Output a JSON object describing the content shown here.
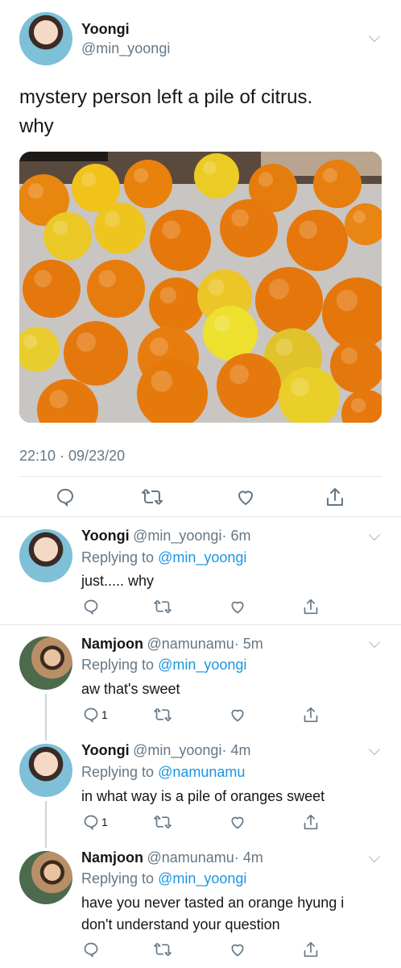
{
  "main_tweet": {
    "author_name": "Yoongi",
    "author_handle": "@min_yoongi",
    "text_line1": "mystery person left a pile of citrus.",
    "text_line2": "why",
    "timestamp": "22:10 · 09/23/20"
  },
  "replies": [
    {
      "author_name": "Yoongi",
      "author_handle": "@min_yoongi",
      "time": "· 6m",
      "replying_prefix": "Replying to ",
      "replying_to": "@min_yoongi",
      "text": "just..... why",
      "reply_count": ""
    },
    {
      "author_name": "Namjoon",
      "author_handle": "@namunamu",
      "time": "· 5m",
      "replying_prefix": "Replying to ",
      "replying_to": "@min_yoongi",
      "text": "aw that's sweet",
      "reply_count": "1"
    },
    {
      "author_name": "Yoongi",
      "author_handle": "@min_yoongi",
      "time": "· 4m",
      "replying_prefix": "Replying to ",
      "replying_to": "@namunamu",
      "text": "in what way is a pile of oranges sweet",
      "reply_count": "1"
    },
    {
      "author_name": "Namjoon",
      "author_handle": "@namunamu",
      "time": "· 4m",
      "replying_prefix": "Replying to ",
      "replying_to": "@min_yoongi",
      "text_line1": "have you never tasted an orange hyung i",
      "text_line2": "don't understand your question",
      "reply_count": ""
    }
  ],
  "colors": {
    "link": "#1b95e0",
    "secondary_text": "#657786",
    "divider": "#e1e8ed"
  },
  "icons": [
    "chevron-down-icon",
    "reply-icon",
    "retweet-icon",
    "like-icon",
    "share-icon"
  ]
}
